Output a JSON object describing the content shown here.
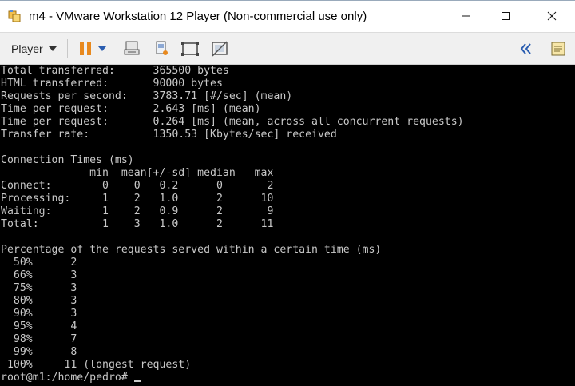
{
  "window": {
    "title": "m4 - VMware Workstation 12 Player (Non-commercial use only)"
  },
  "toolbar": {
    "player_label": "Player",
    "icons": [
      "pause-icon",
      "pause-dropdown-icon",
      "send-ctrl-alt-del-icon",
      "removable-devices-icon",
      "fit-guest-icon",
      "unity-icon",
      "collapse-icon",
      "library-notes-icon"
    ]
  },
  "colors": {
    "pause_orange": "#e8891e",
    "collapse_blue": "#2a5db0",
    "terminal_fg": "#c8c8c8",
    "terminal_bg": "#000000"
  },
  "terminal": {
    "lines": [
      "Total transferred:      365500 bytes",
      "HTML transferred:       90000 bytes",
      "Requests per second:    3783.71 [#/sec] (mean)",
      "Time per request:       2.643 [ms] (mean)",
      "Time per request:       0.264 [ms] (mean, across all concurrent requests)",
      "Transfer rate:          1350.53 [Kbytes/sec] received",
      "",
      "Connection Times (ms)",
      "              min  mean[+/-sd] median   max",
      "Connect:        0    0   0.2      0       2",
      "Processing:     1    2   1.0      2      10",
      "Waiting:        1    2   0.9      2       9",
      "Total:          1    3   1.0      2      11",
      "",
      "Percentage of the requests served within a certain time (ms)",
      "  50%      2",
      "  66%      3",
      "  75%      3",
      "  80%      3",
      "  90%      3",
      "  95%      4",
      "  98%      7",
      "  99%      8",
      " 100%     11 (longest request)"
    ],
    "prompt": "root@m1:/home/pedro# "
  }
}
